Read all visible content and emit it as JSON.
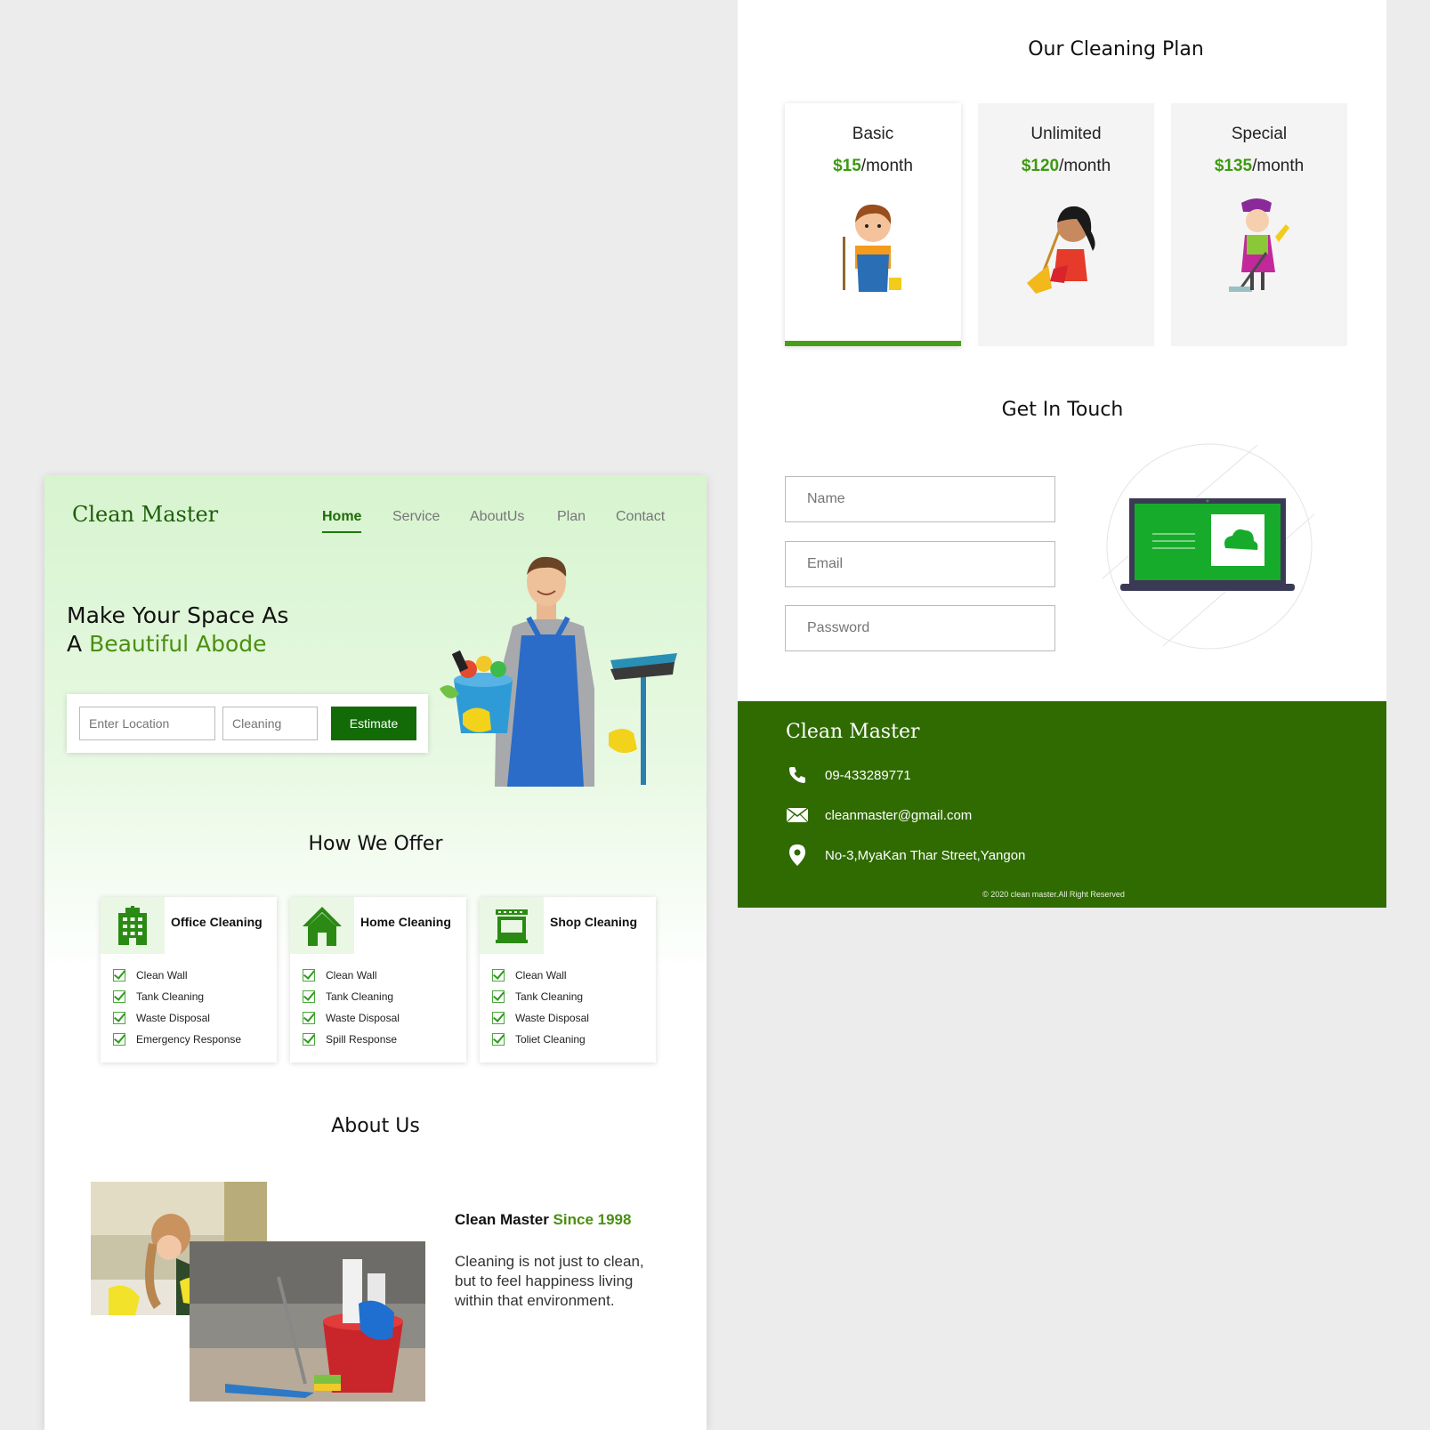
{
  "left": {
    "logo": "Clean Master",
    "nav": [
      {
        "label": "Home",
        "active": true
      },
      {
        "label": "Service",
        "active": false
      },
      {
        "label": "AboutUs",
        "active": false
      },
      {
        "label": "Plan",
        "active": false
      },
      {
        "label": "Contact",
        "active": false
      }
    ],
    "hero": {
      "line1": "Make Your Space As",
      "line2_prefix": "A ",
      "line2_accent": "Beautiful Abode"
    },
    "search": {
      "location_placeholder": "Enter Location",
      "service_placeholder": "Cleaning",
      "estimate_label": "Estimate"
    },
    "offer_title": "How We Offer",
    "offers": [
      {
        "title": "Office Cleaning",
        "icon": "building-icon",
        "items": [
          "Clean Wall",
          "Tank Cleaning",
          "Waste Disposal",
          "Emergency Response"
        ]
      },
      {
        "title": "Home Cleaning",
        "icon": "house-icon",
        "items": [
          "Clean Wall",
          "Tank Cleaning",
          "Waste Disposal",
          "Spill Response"
        ]
      },
      {
        "title": "Shop Cleaning",
        "icon": "shop-icon",
        "items": [
          "Clean Wall",
          "Tank Cleaning",
          "Waste Disposal",
          "Toliet Cleaning"
        ]
      }
    ],
    "about_title": "About Us",
    "about": {
      "heading_prefix": "Clean Master ",
      "heading_accent": "Since 1998",
      "text": "Cleaning is not just to clean, but to feel happiness living within that environment."
    }
  },
  "right": {
    "plan_title": "Our Cleaning Plan",
    "plans": [
      {
        "name": "Basic",
        "price": "$15",
        "period": "/month",
        "active": true
      },
      {
        "name": "Unlimited",
        "price": "$120",
        "period": "/month",
        "active": false
      },
      {
        "name": "Special",
        "price": "$135",
        "period": "/month",
        "active": false
      }
    ],
    "touch_title": "Get In Touch",
    "form": {
      "name_placeholder": "Name",
      "email_placeholder": "Email",
      "password_placeholder": "Password"
    }
  },
  "footer": {
    "logo": "Clean Master",
    "phone": "09-433289771",
    "email": "cleanmaster@gmail.com",
    "address": "No-3,MyaKan Thar Street,Yangon",
    "copyright": "© 2020 clean master.All Right Reserved"
  },
  "colors": {
    "brand_green": "#126b06",
    "accent_green": "#4a8f10",
    "footer_bg": "#2f6b00",
    "page_bg": "#ececec"
  }
}
